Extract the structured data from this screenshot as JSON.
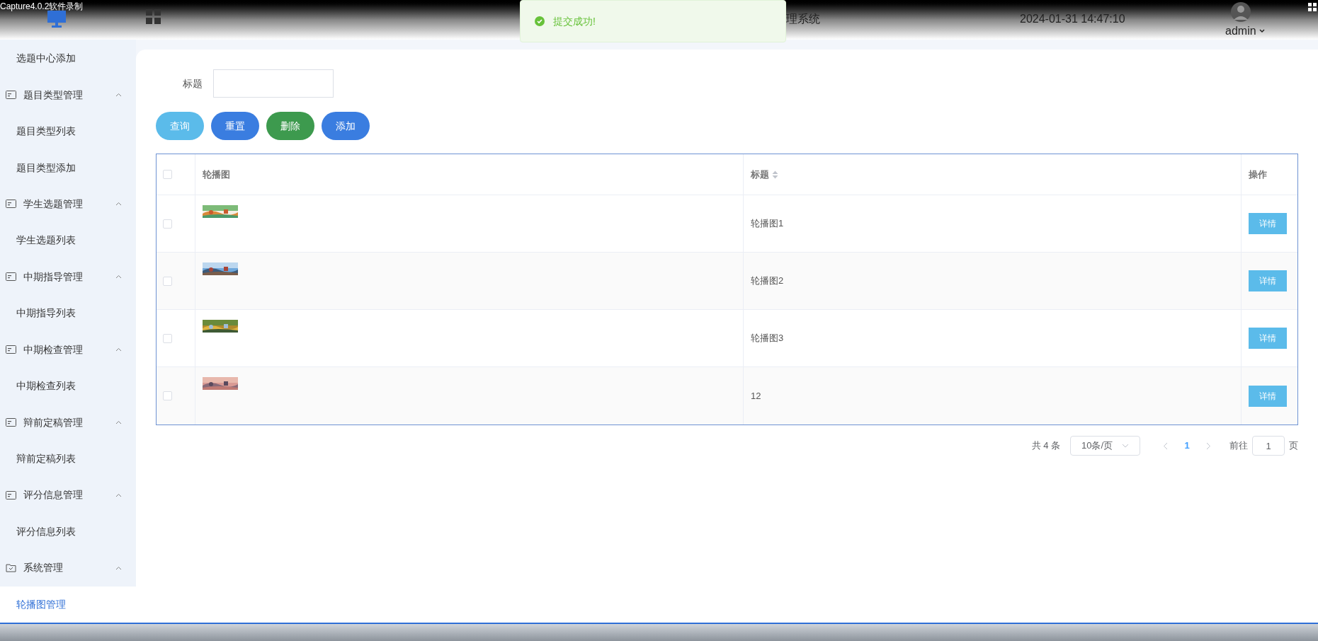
{
  "recorder": {
    "title": "Capture4.0.2软件录制"
  },
  "header": {
    "title": "理系统",
    "datetime": "2024-01-31 14:47:10",
    "user": "admin"
  },
  "toast": {
    "message": "提交成功!"
  },
  "sidebar": {
    "items": [
      {
        "kind": "sub",
        "label": "选题中心添加",
        "selected": false
      },
      {
        "kind": "group",
        "label": "题目类型管理",
        "expanded": true
      },
      {
        "kind": "sub",
        "label": "题目类型列表",
        "selected": false
      },
      {
        "kind": "sub",
        "label": "题目类型添加",
        "selected": false
      },
      {
        "kind": "group",
        "label": "学生选题管理",
        "expanded": true
      },
      {
        "kind": "sub",
        "label": "学生选题列表",
        "selected": false
      },
      {
        "kind": "group",
        "label": "中期指导管理",
        "expanded": true
      },
      {
        "kind": "sub",
        "label": "中期指导列表",
        "selected": false
      },
      {
        "kind": "group",
        "label": "中期检查管理",
        "expanded": true
      },
      {
        "kind": "sub",
        "label": "中期检查列表",
        "selected": false
      },
      {
        "kind": "group",
        "label": "辩前定稿管理",
        "expanded": true
      },
      {
        "kind": "sub",
        "label": "辩前定稿列表",
        "selected": false
      },
      {
        "kind": "group",
        "label": "评分信息管理",
        "expanded": true
      },
      {
        "kind": "sub",
        "label": "评分信息列表",
        "selected": false
      },
      {
        "kind": "folder_group",
        "label": "系统管理",
        "expanded": true
      },
      {
        "kind": "sub",
        "label": "轮播图管理",
        "selected": true
      }
    ]
  },
  "search": {
    "label": "标题"
  },
  "buttons": [
    {
      "label": "查询",
      "color": "#5bbbea"
    },
    {
      "label": "重置",
      "color": "#3a7de0"
    },
    {
      "label": "删除",
      "color": "#3d9a4e"
    },
    {
      "label": "添加",
      "color": "#3a7de0"
    }
  ],
  "table": {
    "columns": [
      {
        "label": "轮播图",
        "sortable": false
      },
      {
        "label": "标题",
        "sortable": true
      },
      {
        "label": "操作",
        "sortable": false
      }
    ],
    "all_checked": false,
    "rows": [
      {
        "checked": false,
        "title": "轮播图1",
        "action": "详情"
      },
      {
        "checked": false,
        "title": "轮播图2",
        "action": "详情"
      },
      {
        "checked": false,
        "title": "轮播图3",
        "action": "详情"
      },
      {
        "checked": false,
        "title": "12",
        "action": "详情"
      }
    ]
  },
  "pagination": {
    "total": "共 4 条",
    "page_size": "10条/页",
    "pages": [
      {
        "label": "1",
        "selected": true
      }
    ],
    "goto_label": "前往",
    "goto_value": "1",
    "page_unit": "页"
  }
}
